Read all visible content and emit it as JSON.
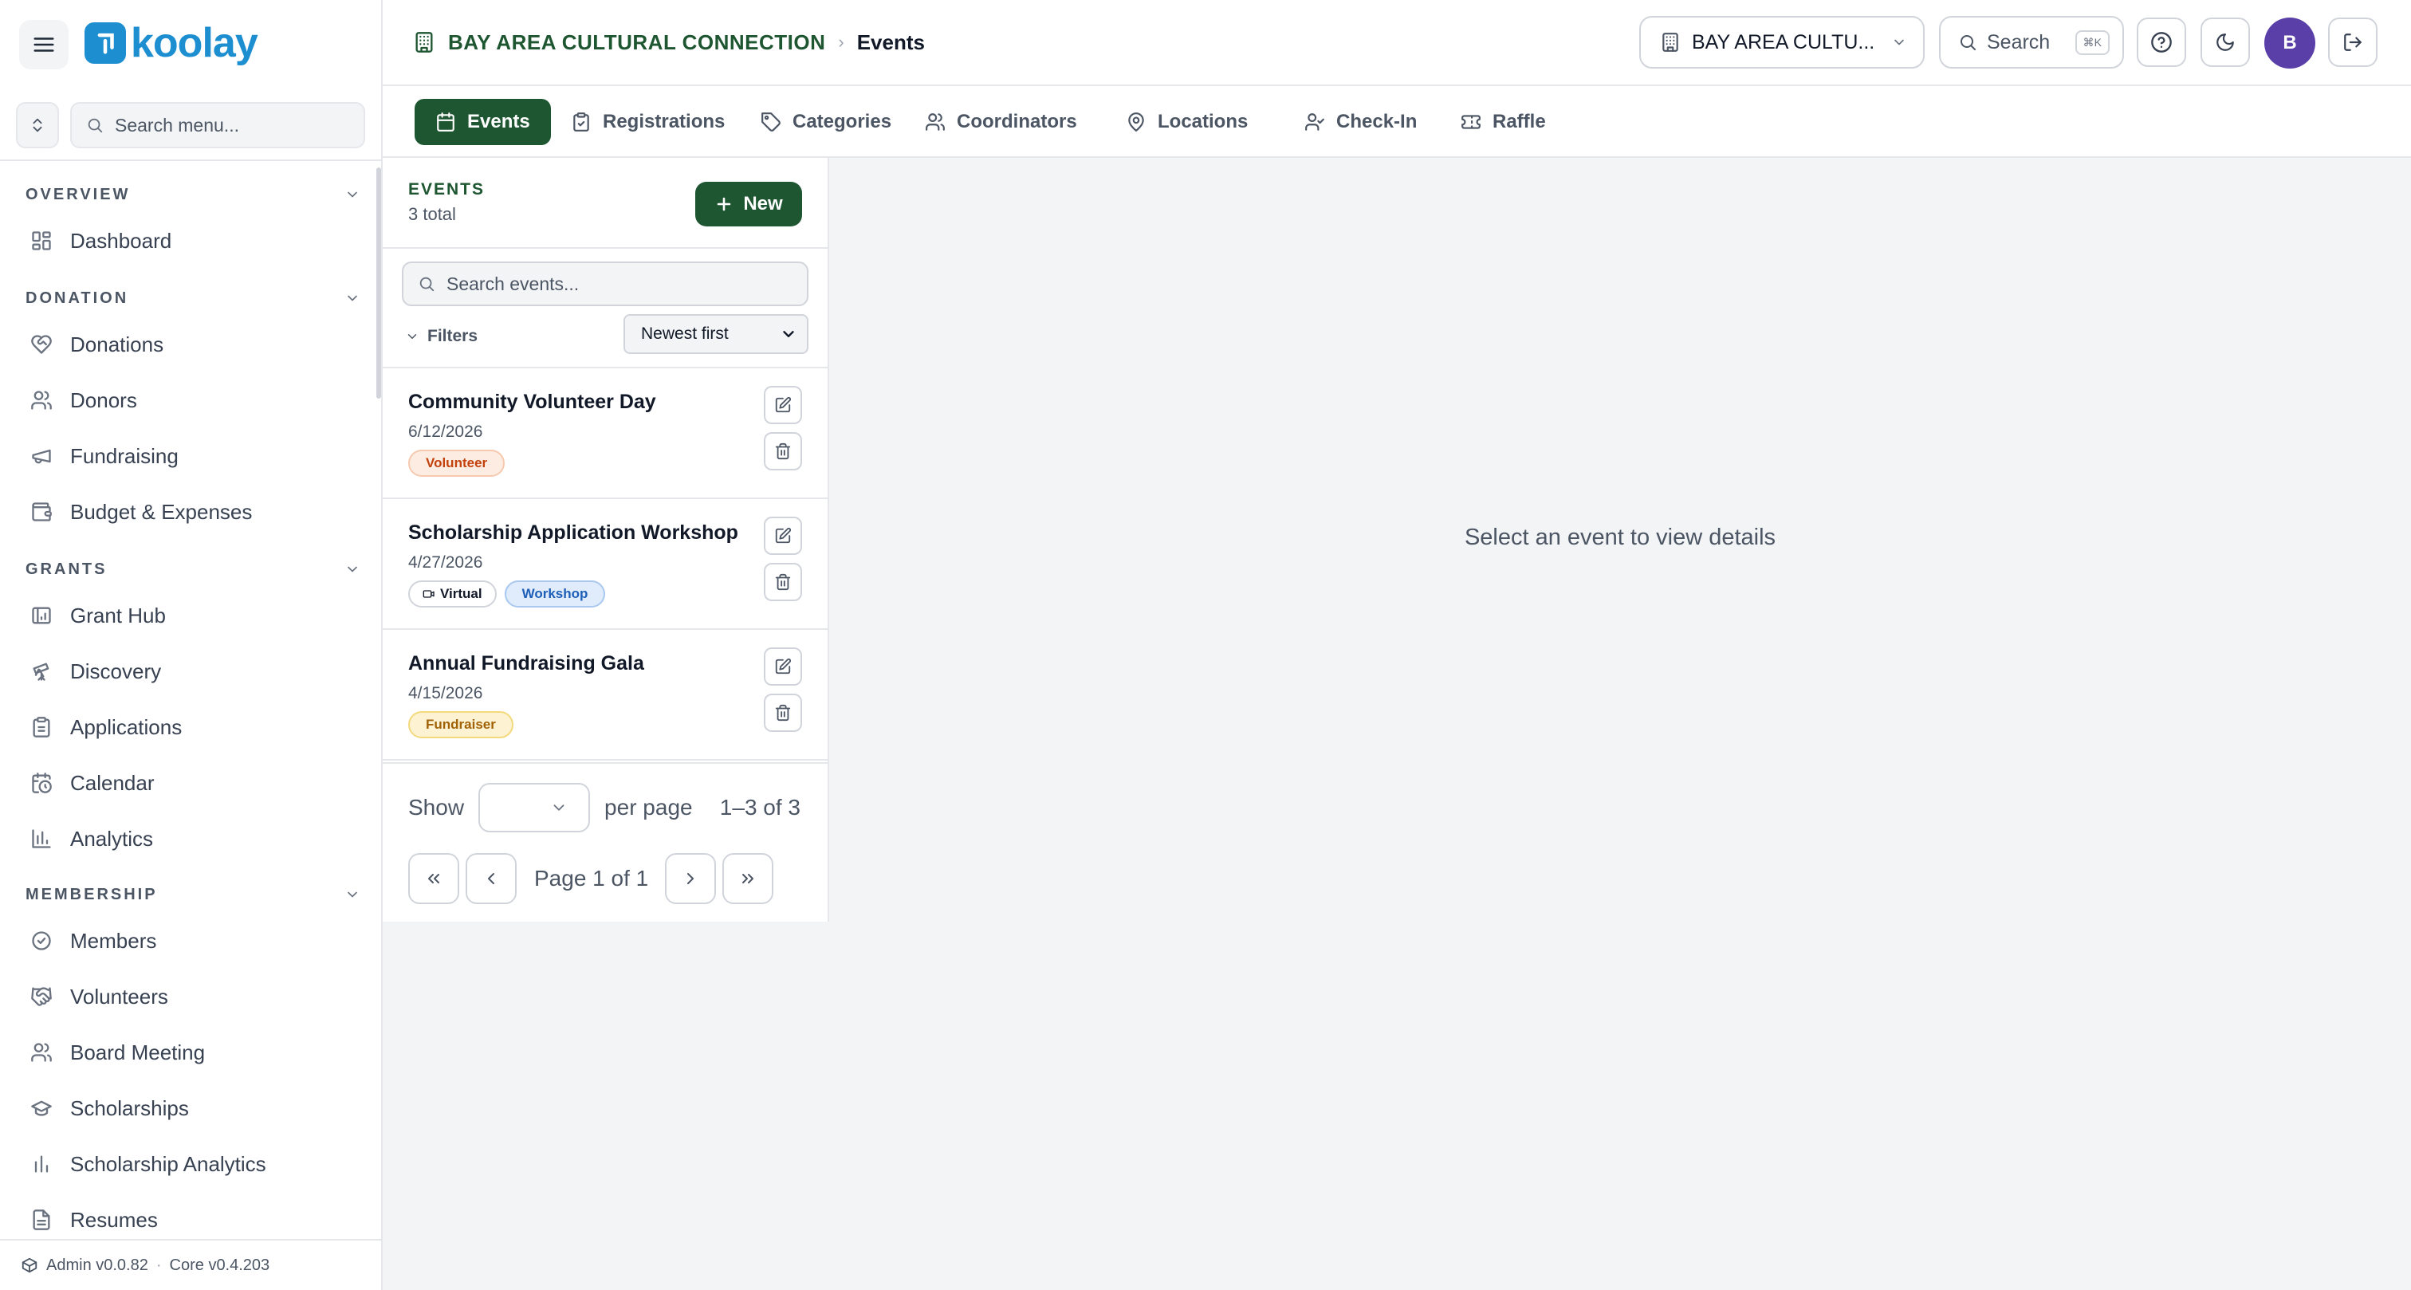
{
  "app": {
    "logo_text": "koolay"
  },
  "sidebar": {
    "search_placeholder": "Search menu...",
    "sections": [
      {
        "title": "OVERVIEW",
        "items": [
          {
            "label": "Dashboard",
            "icon": "grid-icon"
          }
        ]
      },
      {
        "title": "DONATION",
        "items": [
          {
            "label": "Donations",
            "icon": "heart-handshake-icon"
          },
          {
            "label": "Donors",
            "icon": "users-icon"
          },
          {
            "label": "Fundraising",
            "icon": "megaphone-icon"
          },
          {
            "label": "Budget & Expenses",
            "icon": "wallet-icon"
          }
        ]
      },
      {
        "title": "GRANTS",
        "items": [
          {
            "label": "Grant Hub",
            "icon": "chart-board-icon"
          },
          {
            "label": "Discovery",
            "icon": "telescope-icon"
          },
          {
            "label": "Applications",
            "icon": "clipboard-icon"
          },
          {
            "label": "Calendar",
            "icon": "calendar-clock-icon"
          },
          {
            "label": "Analytics",
            "icon": "bar-chart-icon"
          }
        ]
      },
      {
        "title": "MEMBERSHIP",
        "items": [
          {
            "label": "Members",
            "icon": "badge-check-icon"
          },
          {
            "label": "Volunteers",
            "icon": "handshake-icon"
          },
          {
            "label": "Board Meeting",
            "icon": "users-icon"
          },
          {
            "label": "Scholarships",
            "icon": "graduation-cap-icon"
          },
          {
            "label": "Scholarship Analytics",
            "icon": "bar-chart-icon"
          },
          {
            "label": "Resumes",
            "icon": "file-text-icon"
          }
        ]
      }
    ],
    "footer": {
      "admin_version": "Admin v0.0.82",
      "separator": "·",
      "core_version": "Core v0.4.203"
    }
  },
  "header": {
    "org_name": "BAY AREA CULTURAL CONNECTION",
    "separator": "›",
    "current_page": "Events",
    "org_selector_label": "BAY AREA CULTU...",
    "search_label": "Search",
    "search_shortcut": "⌘K",
    "avatar_initial": "B"
  },
  "tabs": [
    {
      "label": "Events",
      "icon": "calendar-icon",
      "active": true
    },
    {
      "label": "Registrations",
      "icon": "clipboard-icon",
      "active": false
    },
    {
      "label": "Categories",
      "icon": "tag-icon",
      "active": false
    },
    {
      "label": "Coordinators",
      "icon": "users-icon",
      "active": false
    },
    {
      "label": "Locations",
      "icon": "map-pin-icon",
      "active": false
    },
    {
      "label": "Check-In",
      "icon": "user-check-icon",
      "active": false
    },
    {
      "label": "Raffle",
      "icon": "ticket-icon",
      "active": false
    }
  ],
  "events_panel": {
    "title": "EVENTS",
    "count_text": "3 total",
    "new_button_label": "New",
    "search_placeholder": "Search events...",
    "filters_label": "Filters",
    "sort_value": "Newest first",
    "events": [
      {
        "name": "Community Volunteer Day",
        "date": "6/12/2026",
        "tags": [
          {
            "label": "Volunteer",
            "style": "orange"
          }
        ]
      },
      {
        "name": "Scholarship Application Workshop",
        "date": "4/27/2026",
        "tags": [
          {
            "label": "Virtual",
            "style": "plain",
            "icon": "video-icon"
          },
          {
            "label": "Workshop",
            "style": "blue"
          }
        ]
      },
      {
        "name": "Annual Fundraising Gala",
        "date": "4/15/2026",
        "tags": [
          {
            "label": "Fundraiser",
            "style": "yellow"
          }
        ]
      }
    ],
    "pagination": {
      "show_label": "Show",
      "per_page_label": "per page",
      "range_text": "1–3 of 3",
      "page_text": "Page 1 of 1"
    }
  },
  "detail": {
    "empty_text": "Select an event to view details"
  },
  "colors": {
    "brand_blue": "#1d8ed0",
    "primary_green": "#1e5631",
    "avatar_purple": "#5b3fa8"
  }
}
